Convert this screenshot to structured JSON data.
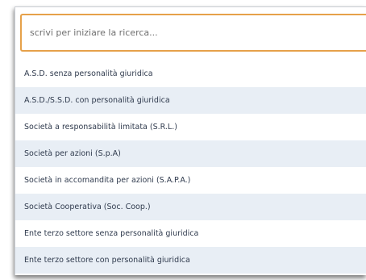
{
  "search": {
    "placeholder": "scrivi per iniziare la ricerca..."
  },
  "options": [
    "A.S.D. senza personalità giuridica",
    "A.S.D./S.S.D. con personalità giuridica",
    "Società a responsabilità limitata (S.R.L.)",
    "Società per azioni (S.p.A)",
    "Società in accomandita per azioni (S.A.P.A.)",
    "Società Cooperativa (Soc. Coop.)",
    "Ente terzo settore senza personalità giuridica",
    "Ente terzo settore con personalità giuridica"
  ],
  "colors": {
    "focus_border": "#e6a14a",
    "row_alt": "#e8eef5",
    "text": "#2f3a4d"
  }
}
